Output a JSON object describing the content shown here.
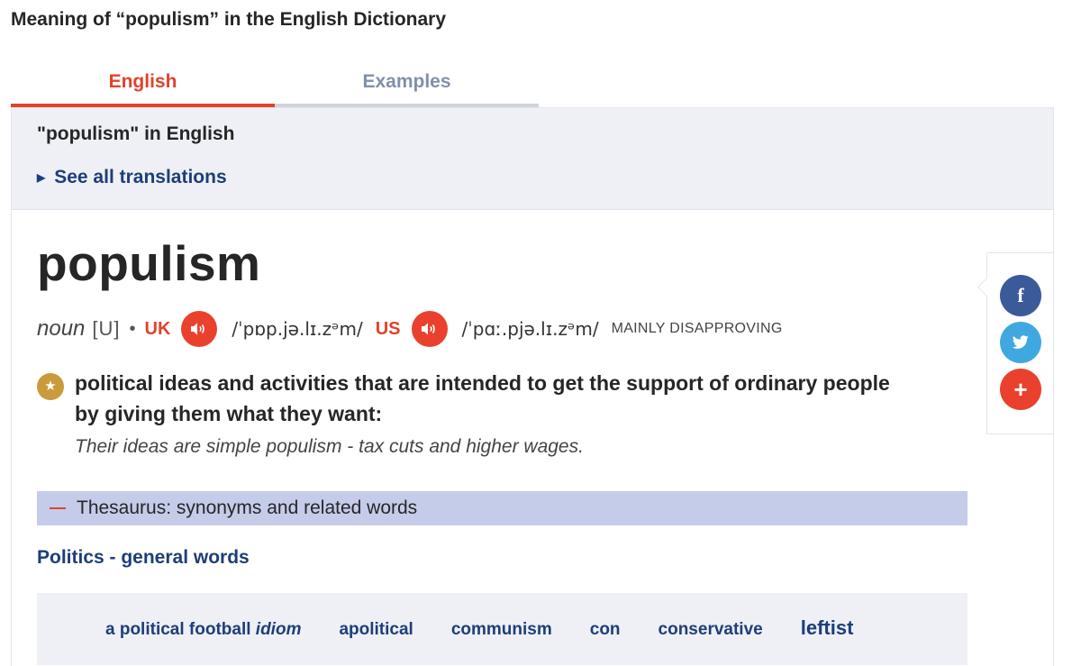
{
  "page_heading": "Meaning of “populism” in the English Dictionary",
  "tabs": [
    {
      "label": "English",
      "active": true
    },
    {
      "label": "Examples",
      "active": false
    }
  ],
  "translations": {
    "title": "\"populism\" in English",
    "see_all": "See all translations"
  },
  "entry": {
    "headword": "populism",
    "pos": "noun",
    "grammar": "[U]",
    "uk": {
      "label": "UK",
      "ipa": "/ˈpɒp.jə.lɪ.zᵊm/"
    },
    "us": {
      "label": "US",
      "ipa": "/ˈpɑː.pjə.lɪ.zᵊm/"
    },
    "usage": "MAINLY DISAPPROVING",
    "definition": "political ideas and activities that are intended to get the support of ordinary people by giving them what they want:",
    "example": "Their ideas are simple populism - tax cuts and higher wages."
  },
  "thesaurus": {
    "label": "Thesaurus: synonyms and related words",
    "topic": "Politics - general words",
    "words": [
      {
        "text": "a political football",
        "suffix": "idiom"
      },
      {
        "text": "apolitical"
      },
      {
        "text": "communism"
      },
      {
        "text": "con"
      },
      {
        "text": "conservative"
      },
      {
        "text": "leftist"
      }
    ]
  },
  "share": {
    "facebook": {
      "icon": "facebook-icon",
      "glyph": "f",
      "color": "#3b5a9a"
    },
    "twitter": {
      "icon": "twitter-icon",
      "color": "#40a8e0"
    },
    "more": {
      "icon": "plus-icon",
      "glyph": "+",
      "color": "#e9412e"
    }
  },
  "colors": {
    "accent": "#e0432b",
    "link": "#1d3e7a",
    "star": "#c99b3c",
    "thesaurus_bar": "#c5cce9"
  }
}
